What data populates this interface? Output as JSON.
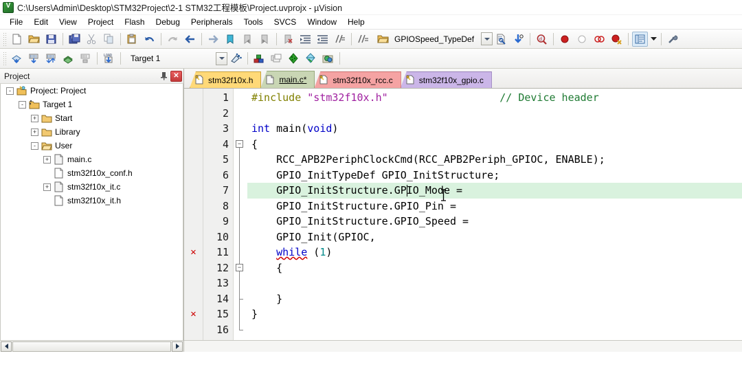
{
  "titlebar": {
    "icon": "uvision-logo-icon",
    "text": "C:\\Users\\Admin\\Desktop\\STM32Project\\2-1 STM32工程模板\\Project.uvprojx - µVision"
  },
  "menubar": {
    "items": [
      {
        "label": "File"
      },
      {
        "label": "Edit"
      },
      {
        "label": "View"
      },
      {
        "label": "Project"
      },
      {
        "label": "Flash"
      },
      {
        "label": "Debug"
      },
      {
        "label": "Peripherals"
      },
      {
        "label": "Tools"
      },
      {
        "label": "SVCS"
      },
      {
        "label": "Window"
      },
      {
        "label": "Help"
      }
    ]
  },
  "toolbar_main": {
    "buttons": [
      {
        "name": "new-file-icon",
        "title": "New"
      },
      {
        "name": "open-file-icon",
        "title": "Open"
      },
      {
        "name": "save-icon",
        "title": "Save"
      },
      {
        "name": "save-all-icon",
        "title": "Save All"
      },
      {
        "name": "cut-icon",
        "title": "Cut"
      },
      {
        "name": "copy-icon",
        "title": "Copy"
      },
      {
        "name": "paste-icon",
        "title": "Paste"
      },
      {
        "name": "undo-icon",
        "title": "Undo"
      },
      {
        "name": "redo-icon",
        "title": "Redo"
      },
      {
        "name": "navigate-back-icon",
        "title": "Back"
      },
      {
        "name": "navigate-forward-icon",
        "title": "Forward"
      },
      {
        "name": "bookmark-toggle-icon",
        "title": "Insert/Remove Bookmark"
      },
      {
        "name": "bookmark-prev-icon",
        "title": "Previous Bookmark"
      },
      {
        "name": "bookmark-next-icon",
        "title": "Next Bookmark"
      },
      {
        "name": "bookmark-clear-icon",
        "title": "Clear All Bookmarks"
      },
      {
        "name": "indent-icon",
        "title": "Indent"
      },
      {
        "name": "outdent-icon",
        "title": "Outdent"
      },
      {
        "name": "comment-icon",
        "title": "Comment"
      },
      {
        "name": "uncomment-icon",
        "title": "Uncomment"
      },
      {
        "name": "open-folder-icon",
        "title": "Open Document"
      }
    ],
    "typedef_combo": {
      "value": "GPIOSpeed_TypeDef",
      "arrow": "chevron-down-icon"
    },
    "after_combo": [
      {
        "name": "find-in-files-icon",
        "title": "Find in Files"
      },
      {
        "name": "bookmark-search-icon",
        "title": "Find Next"
      },
      {
        "name": "magnifier-icon",
        "title": "Search"
      },
      {
        "name": "breakpoint-insert-icon",
        "title": "Insert/Remove Breakpoint"
      },
      {
        "name": "breakpoint-disable-icon",
        "title": "Enable/Disable Breakpoint"
      },
      {
        "name": "breakpoint-disable-all-icon",
        "title": "Disable All Breakpoints"
      },
      {
        "name": "breakpoint-kill-all-icon",
        "title": "Kill All Breakpoints"
      },
      {
        "name": "project-window-icon",
        "title": "Project Window"
      },
      {
        "name": "chevron-down-icon",
        "title": "More"
      },
      {
        "name": "configure-icon",
        "title": "Configuration"
      }
    ]
  },
  "toolbar_build": {
    "buttons": [
      {
        "name": "translate-icon",
        "title": "Translate"
      },
      {
        "name": "build-icon",
        "title": "Build"
      },
      {
        "name": "rebuild-icon",
        "title": "Rebuild"
      },
      {
        "name": "batch-build-icon",
        "title": "Batch Build"
      },
      {
        "name": "stop-build-icon",
        "title": "Stop Build"
      },
      {
        "name": "download-icon",
        "title": "Download"
      }
    ],
    "target": {
      "value": "Target 1",
      "arrow": "chevron-down-icon",
      "options_icon": "target-options-icon"
    },
    "right_buttons": [
      {
        "name": "manage-project-items-icon",
        "title": "Manage Project Items"
      },
      {
        "name": "multi-project-icon",
        "title": "Multi-Project"
      },
      {
        "name": "pack-installer-icon",
        "title": "Pack Installer"
      },
      {
        "name": "manage-run-time-icon",
        "title": "Manage Run-Time Environment"
      },
      {
        "name": "select-software-packs-icon",
        "title": "Select Software Packs"
      }
    ]
  },
  "project_panel": {
    "title": "Project",
    "pin_icon": "pin-icon",
    "close_icon": "close-icon",
    "tree": [
      {
        "label": "Project: Project",
        "depth": 0,
        "expander": "-",
        "icon": "project-icon"
      },
      {
        "label": "Target 1",
        "depth": 1,
        "expander": "-",
        "icon": "target-folder-icon"
      },
      {
        "label": "Start",
        "depth": 2,
        "expander": "+",
        "icon": "group-folder-icon"
      },
      {
        "label": "Library",
        "depth": 2,
        "expander": "+",
        "icon": "group-folder-icon"
      },
      {
        "label": "User",
        "depth": 2,
        "expander": "-",
        "icon": "group-folder-open-icon"
      },
      {
        "label": "main.c",
        "depth": 3,
        "expander": "+",
        "icon": "c-file-icon"
      },
      {
        "label": "stm32f10x_conf.h",
        "depth": 3,
        "expander": "",
        "icon": "h-file-icon"
      },
      {
        "label": "stm32f10x_it.c",
        "depth": 3,
        "expander": "+",
        "icon": "c-file-icon"
      },
      {
        "label": "stm32f10x_it.h",
        "depth": 3,
        "expander": "",
        "icon": "h-file-icon"
      }
    ],
    "hscrollbar": {
      "left_icon": "scroll-left-icon",
      "right_icon": "scroll-right-icon"
    }
  },
  "editor": {
    "tabs": [
      {
        "label": "stm32f10x.h",
        "color": "#ffd978",
        "border": "#c9a33a",
        "icon": "header-file-icon",
        "active": false
      },
      {
        "label": "main.c*",
        "color": "#c9d6b4",
        "border": "#98a97e",
        "icon": "source-file-icon",
        "active": true
      },
      {
        "label": "stm32f10x_rcc.c",
        "color": "#f5a3a3",
        "border": "#cc7272",
        "icon": "header-file-icon",
        "active": false
      },
      {
        "label": "stm32f10x_gpio.c",
        "color": "#cbb6e8",
        "border": "#9a84bd",
        "icon": "header-file-icon",
        "active": false
      }
    ],
    "highlighted_line": 7,
    "error_lines": [
      11,
      15
    ],
    "fold_lines": [
      4,
      12
    ],
    "lines": [
      {
        "n": 1,
        "tokens": [
          {
            "t": "#include ",
            "c": "pre"
          },
          {
            "t": "\"stm32f10x.h\"",
            "c": "str"
          }
        ],
        "trailing_comment": "// Device header"
      },
      {
        "n": 2,
        "tokens": []
      },
      {
        "n": 3,
        "tokens": [
          {
            "t": "int ",
            "c": "kw"
          },
          {
            "t": "main(",
            "c": ""
          },
          {
            "t": "void",
            "c": "kw"
          },
          {
            "t": ")",
            "c": ""
          }
        ]
      },
      {
        "n": 4,
        "tokens": [
          {
            "t": "{",
            "c": ""
          }
        ]
      },
      {
        "n": 5,
        "tokens": [
          {
            "t": "    RCC_APB2PeriphClockCmd(RCC_APB2Periph_GPIOC, ENABLE);",
            "c": ""
          }
        ]
      },
      {
        "n": 6,
        "tokens": [
          {
            "t": "    GPIO_InitTypeDef GPIO_InitStructure;",
            "c": ""
          }
        ]
      },
      {
        "n": 7,
        "tokens": [
          {
            "t": "    GPIO_InitStructure.GPIO_Mode =",
            "c": ""
          }
        ]
      },
      {
        "n": 8,
        "tokens": [
          {
            "t": "    GPIO_InitStructure.GPIO_Pin =",
            "c": ""
          }
        ]
      },
      {
        "n": 9,
        "tokens": [
          {
            "t": "    GPIO_InitStructure.GPIO_Speed =",
            "c": ""
          }
        ]
      },
      {
        "n": 10,
        "tokens": [
          {
            "t": "    GPIO_Init(GPIOC,",
            "c": ""
          }
        ]
      },
      {
        "n": 11,
        "tokens": [
          {
            "t": "    ",
            "c": ""
          },
          {
            "t": "while",
            "c": "err"
          },
          {
            "t": " (",
            "c": ""
          },
          {
            "t": "1",
            "c": "num"
          },
          {
            "t": ")",
            "c": ""
          }
        ]
      },
      {
        "n": 12,
        "tokens": [
          {
            "t": "    {",
            "c": ""
          }
        ]
      },
      {
        "n": 13,
        "tokens": []
      },
      {
        "n": 14,
        "tokens": [
          {
            "t": "    }",
            "c": ""
          }
        ]
      },
      {
        "n": 15,
        "tokens": [
          {
            "t": "}",
            "c": ""
          }
        ]
      },
      {
        "n": 16,
        "tokens": []
      }
    ]
  },
  "colors": {
    "keyword": "#0000c8",
    "string": "#a020a0",
    "preprocessor": "#808000",
    "comment": "#1e7a32",
    "number": "#008a8a",
    "error_marker": "#cc0000",
    "highlight_line": "#d9f2de"
  }
}
